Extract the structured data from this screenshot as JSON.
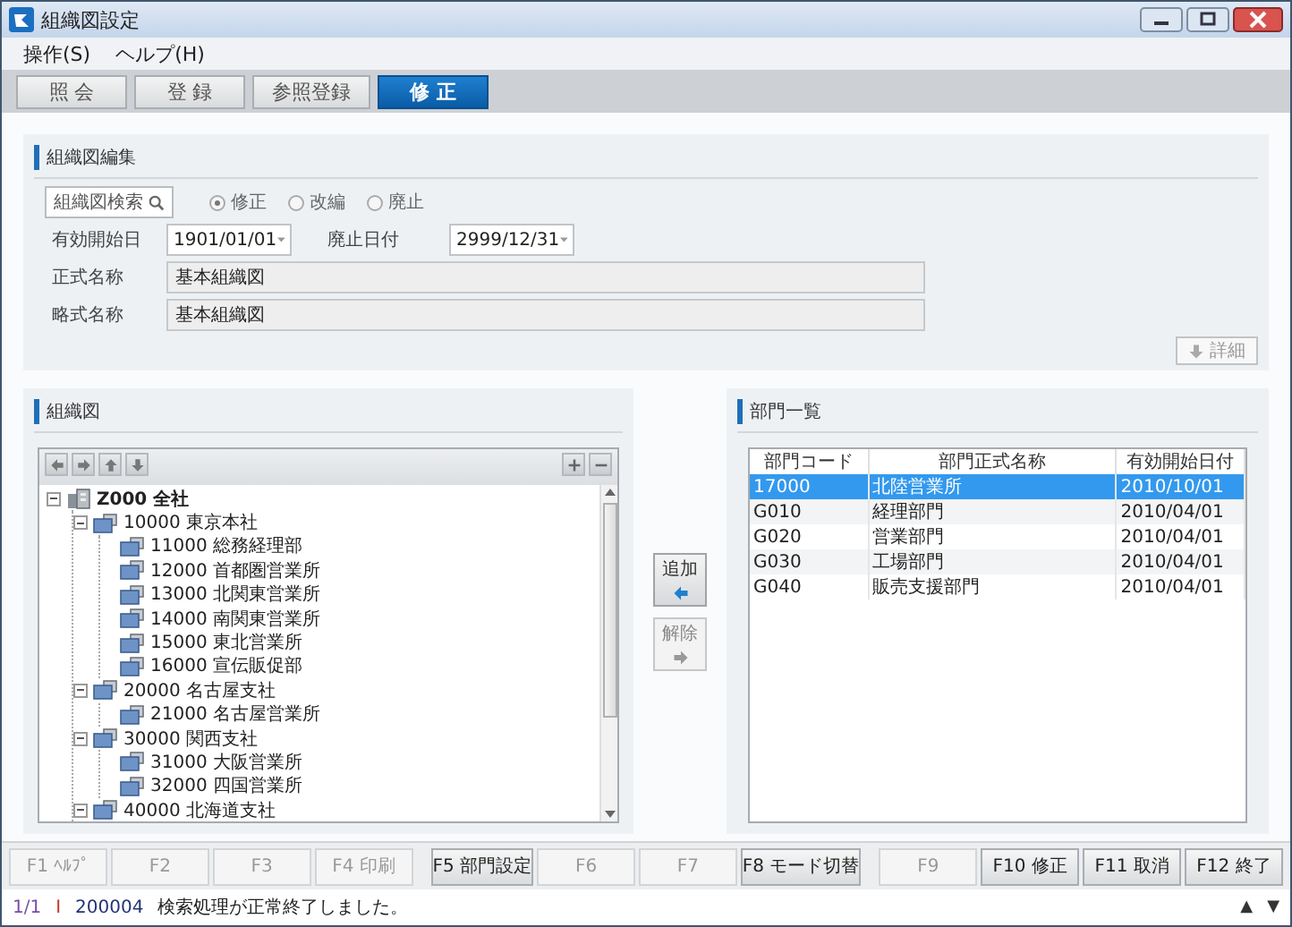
{
  "window": {
    "title": "組織図設定"
  },
  "menu": [
    "操作(S)",
    "ヘルプ(H)"
  ],
  "mode_tabs": [
    {
      "label": "照 会",
      "selected": false
    },
    {
      "label": "登 録",
      "selected": false
    },
    {
      "label": "参照登録",
      "selected": false
    },
    {
      "label": "修 正",
      "selected": true
    }
  ],
  "edit_panel": {
    "title": "組織図編集",
    "search_button": "組織図検索",
    "radios": [
      {
        "label": "修正",
        "selected": true
      },
      {
        "label": "改編",
        "selected": false
      },
      {
        "label": "廃止",
        "selected": false
      }
    ],
    "start_date": {
      "label": "有効開始日",
      "value": "1901/01/01"
    },
    "end_date": {
      "label": "廃止日付",
      "value": "2999/12/31"
    },
    "formal_name": {
      "label": "正式名称",
      "value": "基本組織図"
    },
    "short_name": {
      "label": "略式名称",
      "value": "基本組織図"
    },
    "detail_button": {
      "label": "詳細",
      "disabled": true
    }
  },
  "tree_panel": {
    "title": "組織図",
    "tree": [
      {
        "label": "Z000 全社",
        "kind": "company",
        "expanded": true,
        "children": [
          {
            "label": "10000 東京本社",
            "kind": "office",
            "expanded": true,
            "children": [
              {
                "label": "11000 総務経理部",
                "kind": "office"
              },
              {
                "label": "12000 首都圏営業所",
                "kind": "office"
              },
              {
                "label": "13000 北関東営業所",
                "kind": "office"
              },
              {
                "label": "14000 南関東営業所",
                "kind": "office"
              },
              {
                "label": "15000 東北営業所",
                "kind": "office"
              },
              {
                "label": "16000 宣伝販促部",
                "kind": "office"
              }
            ]
          },
          {
            "label": "20000 名古屋支社",
            "kind": "office",
            "expanded": true,
            "children": [
              {
                "label": "21000 名古屋営業所",
                "kind": "office"
              }
            ]
          },
          {
            "label": "30000 関西支社",
            "kind": "office",
            "expanded": true,
            "children": [
              {
                "label": "31000 大阪営業所",
                "kind": "office"
              },
              {
                "label": "32000 四国営業所",
                "kind": "office"
              }
            ]
          },
          {
            "label": "40000 北海道支社",
            "kind": "office",
            "expanded": true
          }
        ]
      }
    ]
  },
  "move_buttons": [
    {
      "label": "追加",
      "kind": "add",
      "disabled": false
    },
    {
      "label": "解除",
      "kind": "remove",
      "disabled": true
    }
  ],
  "dept_panel": {
    "title": "部門一覧",
    "columns": [
      "部門コード",
      "部門正式名称",
      "有効開始日付"
    ],
    "rows": [
      {
        "cells": [
          "17000",
          "北陸営業所",
          "2010/10/01"
        ],
        "selected": true
      },
      {
        "cells": [
          "G010",
          "経理部門",
          "2010/04/01"
        ],
        "selected": false
      },
      {
        "cells": [
          "G020",
          "営業部門",
          "2010/04/01"
        ],
        "selected": false
      },
      {
        "cells": [
          "G030",
          "工場部門",
          "2010/04/01"
        ],
        "selected": false
      },
      {
        "cells": [
          "G040",
          "販売支援部門",
          "2010/04/01"
        ],
        "selected": false
      }
    ]
  },
  "function_keys": [
    {
      "label": "F1 ﾍﾙﾌﾟ",
      "disabled": true
    },
    {
      "label": "F2",
      "disabled": true
    },
    {
      "label": "F3",
      "disabled": true
    },
    {
      "label": "F4 印刷",
      "disabled": true
    },
    {
      "label": "F5 部門設定",
      "disabled": false
    },
    {
      "label": "F6",
      "disabled": true
    },
    {
      "label": "F7",
      "disabled": true
    },
    {
      "label": "F8 モード切替",
      "disabled": false
    },
    {
      "label": "F9",
      "disabled": true
    },
    {
      "label": "F10 修正",
      "disabled": false
    },
    {
      "label": "F11 取消",
      "disabled": false
    },
    {
      "label": "F12 終了",
      "disabled": false
    }
  ],
  "status_bar": {
    "page": "1/1",
    "level": "I",
    "code": "200004",
    "message": "検索処理が正常終了しました。",
    "prev": "▲",
    "next": "▼"
  }
}
